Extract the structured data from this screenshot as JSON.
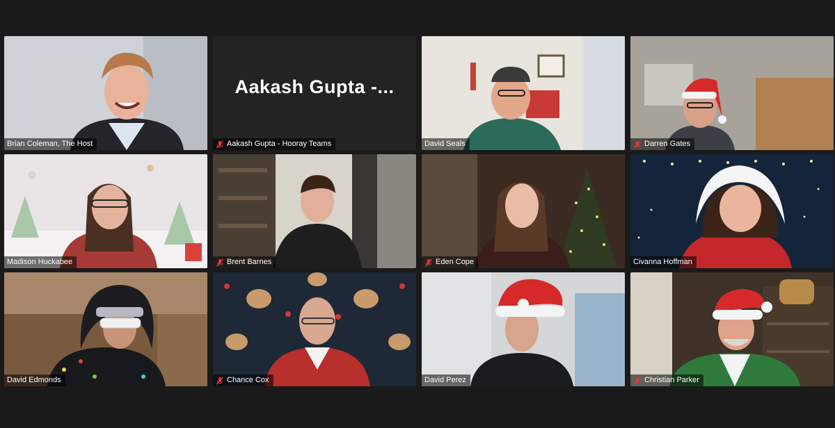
{
  "participants": [
    {
      "name": "Brian Coleman, The Host",
      "muted": false,
      "active": false,
      "has_video": true
    },
    {
      "name": "Aakash Gupta - Hooray Teams",
      "display_text": "Aakash  Gupta  -...",
      "muted": true,
      "active": false,
      "has_video": false
    },
    {
      "name": "David Seals",
      "muted": false,
      "active": false,
      "has_video": true
    },
    {
      "name": "Darren Gates",
      "muted": true,
      "active": false,
      "has_video": true
    },
    {
      "name": "Madison Huckabee",
      "muted": false,
      "active": false,
      "has_video": true
    },
    {
      "name": "Brent Barnes",
      "muted": true,
      "active": false,
      "has_video": true
    },
    {
      "name": "Eden Cope",
      "muted": true,
      "active": false,
      "has_video": true
    },
    {
      "name": "Civanna Hoffman",
      "muted": false,
      "active": false,
      "has_video": true
    },
    {
      "name": "David Edmonds",
      "muted": false,
      "active": true,
      "has_video": true
    },
    {
      "name": "Chance Cox",
      "muted": true,
      "active": false,
      "has_video": true
    },
    {
      "name": "David Perez",
      "muted": false,
      "active": false,
      "has_video": true
    },
    {
      "name": "Christian Parker",
      "muted": true,
      "active": false,
      "has_video": true
    }
  ],
  "colors": {
    "background": "#1a1a1a",
    "active_speaker_border": "#d4e36a",
    "muted_icon": "#e0383e"
  },
  "icons": {
    "muted": "mic-muted-icon"
  }
}
